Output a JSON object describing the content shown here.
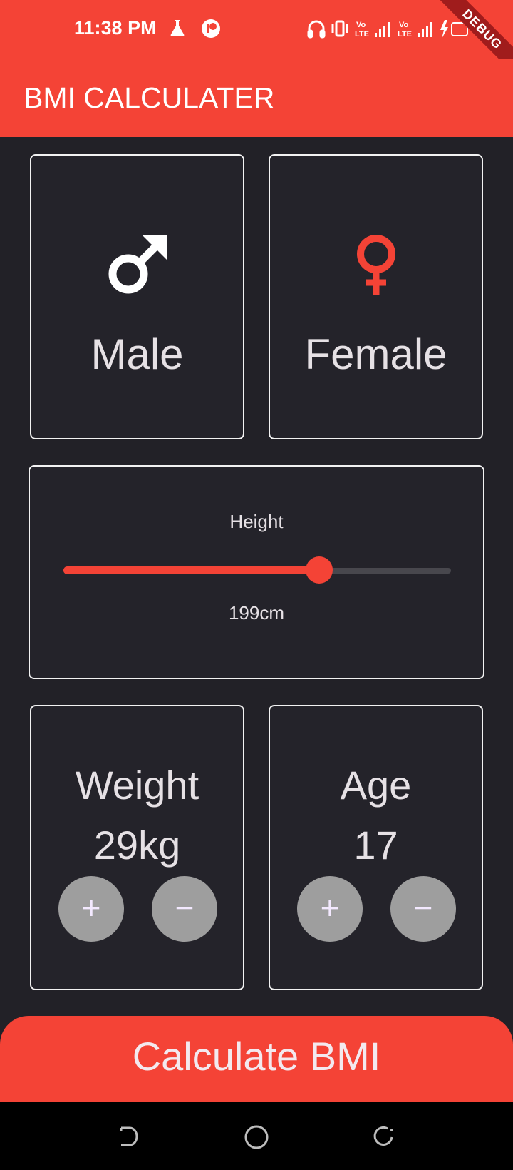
{
  "status_bar": {
    "time": "11:38 PM",
    "debug_label": "DEBUG",
    "icons": [
      "flask-icon",
      "circle-icon",
      "headphones-icon",
      "vibrate-icon",
      "volte-icon",
      "signal-icon",
      "volte-icon",
      "signal-icon",
      "battery-charging-icon"
    ]
  },
  "app_bar": {
    "title": "BMI CALCULATER"
  },
  "gender": {
    "male": {
      "label": "Male",
      "icon": "male-icon",
      "icon_color": "#ffffff"
    },
    "female": {
      "label": "Female",
      "icon": "female-icon",
      "icon_color": "#f44336"
    }
  },
  "height": {
    "title": "Height",
    "value_label": "199cm",
    "slider_fraction": 0.66
  },
  "weight": {
    "label": "Weight",
    "value": "29kg",
    "plus": "+",
    "minus": "−"
  },
  "age": {
    "label": "Age",
    "value": "17",
    "plus": "+",
    "minus": "−"
  },
  "calculate_button": {
    "label": "Calculate BMI"
  },
  "colors": {
    "accent": "#f44336",
    "background": "#222127",
    "card_border": "#f2f2f2",
    "button_grey": "#9e9e9e"
  }
}
